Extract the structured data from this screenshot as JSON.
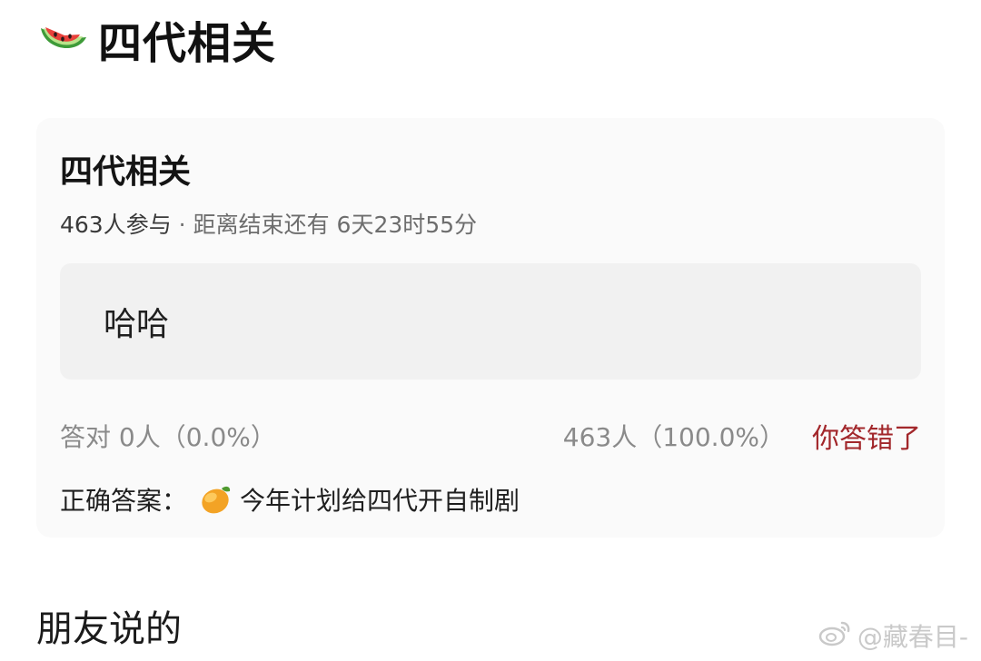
{
  "header": {
    "icon": "watermelon-icon",
    "title": "四代相关"
  },
  "quiz": {
    "title": "四代相关",
    "participants": "463人参与",
    "separator": "·",
    "countdown_label": "距离结束还有",
    "countdown_value": "6天23时55分",
    "option_text": "哈哈",
    "correct_label": "答对",
    "correct_stats": "0人（0.0%）",
    "option_stats": "463人（100.0%）",
    "user_result": "你答错了",
    "answer_label": "正确答案：",
    "answer_icon": "mango-icon",
    "answer_text": "今年计划给四代开自制剧"
  },
  "friends_section": {
    "title": "朋友说的"
  },
  "watermark": {
    "icon": "weibo-icon",
    "text": "@藏春目-"
  },
  "colors": {
    "card_bg": "#fafafa",
    "option_bg": "#f1f1f1",
    "wrong_red": "#a2272b",
    "muted_gray": "#8a8a8a"
  }
}
